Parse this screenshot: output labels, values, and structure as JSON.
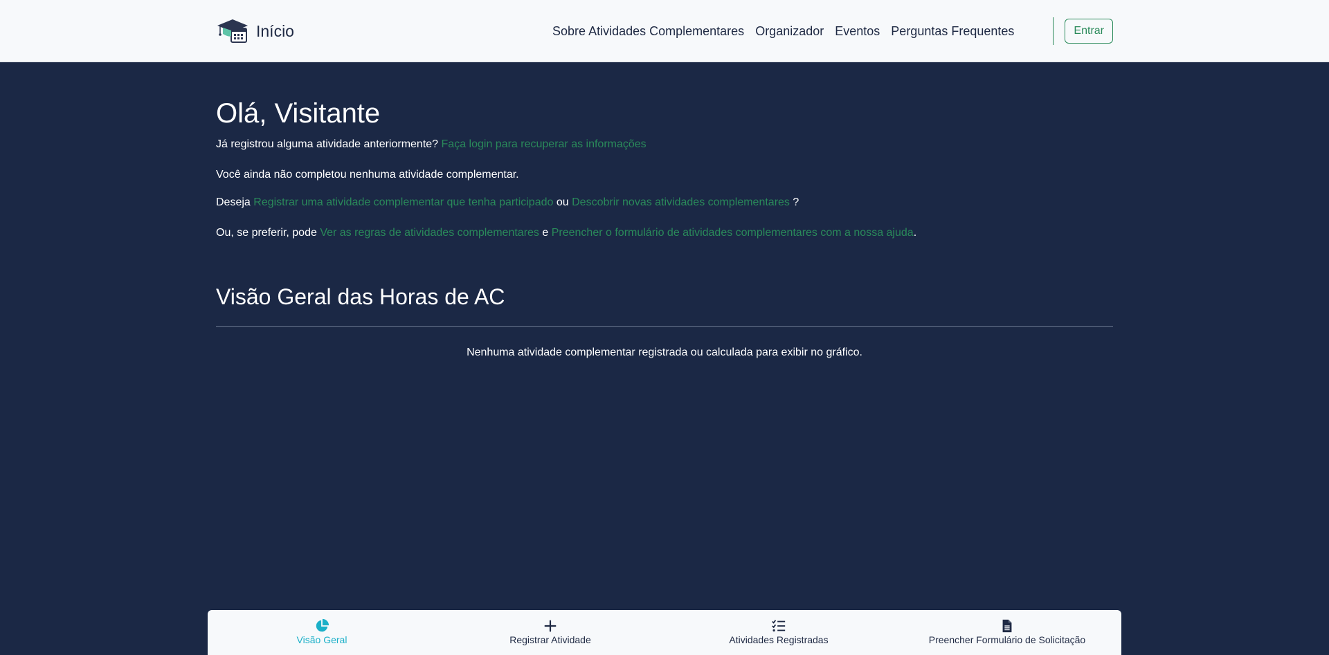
{
  "navbar": {
    "brand": "Início",
    "links": [
      "Sobre Atividades Complementares",
      "Organizador",
      "Eventos",
      "Perguntas Frequentes"
    ],
    "login_label": "Entrar",
    "accent_color": "#2a8a5a"
  },
  "main": {
    "greeting": "Olá, Visitante",
    "login_prompt": "Já registrou alguma atividade anteriormente?",
    "login_link": "Faça login para recuperar as informações",
    "no_activity": "Você ainda não completou nenhuma atividade complementar.",
    "deseja_prefix": "Deseja",
    "register_link": "Registrar uma atividade complementar que tenha participado",
    "ou_word": "ou",
    "discover_link": "Descobrir novas atividades complementares",
    "question_mark": "?",
    "prefer_prefix": "Ou, se preferir, pode",
    "rules_link": "Ver as regras de atividades complementares",
    "e_word": "e",
    "form_link": "Preencher o formulário de atividades complementares com a nossa ajuda",
    "period": "."
  },
  "overview": {
    "title": "Visão Geral das Horas de AC",
    "empty_message": "Nenhuma atividade complementar registrada ou calculada para exibir no gráfico."
  },
  "tabbar": {
    "tabs": [
      {
        "label": "Visão Geral",
        "icon": "pie-chart-icon",
        "active": true
      },
      {
        "label": "Registrar Atividade",
        "icon": "plus-icon",
        "active": false
      },
      {
        "label": "Atividades Registradas",
        "icon": "checklist-icon",
        "active": false
      },
      {
        "label": "Preencher Formulário de Solicitação",
        "icon": "document-icon",
        "active": false
      }
    ],
    "active_color": "#1bb0c8"
  }
}
